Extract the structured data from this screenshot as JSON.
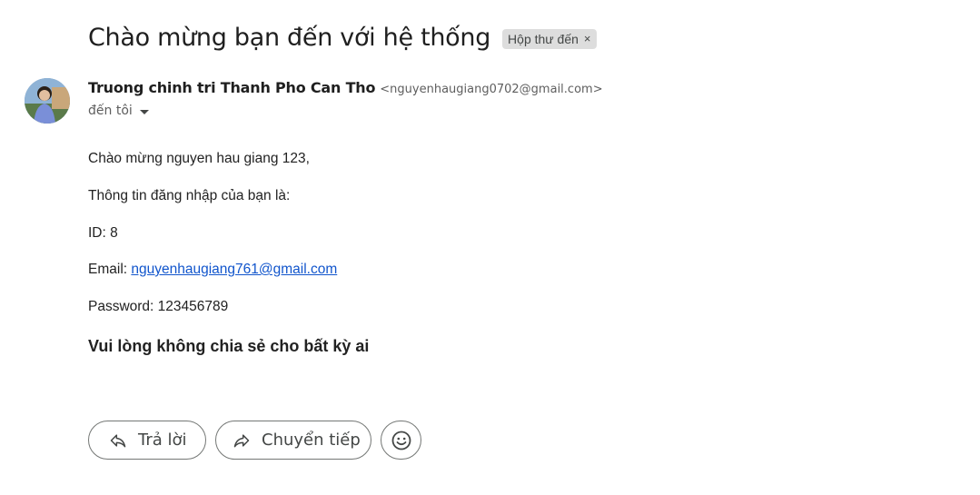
{
  "subject": "Chào mừng bạn đến với hệ thống",
  "label": {
    "text": "Hộp thư đến",
    "close": "×"
  },
  "sender": {
    "name": "Truong chinh tri Thanh Pho Can Tho",
    "email": "<nguyenhaugiang0702@gmail.com>",
    "to": "đến tôi"
  },
  "body": {
    "greeting": "Chào mừng nguyen hau giang 123,",
    "info_intro": "Thông tin đăng nhập của bạn là:",
    "id_line": "ID: 8",
    "email_label": "Email: ",
    "email_link": "nguyenhaugiang761@gmail.com",
    "password_line": "Password: 123456789",
    "warning": "Vui lòng không chia sẻ cho bất kỳ ai"
  },
  "actions": {
    "reply": "Trả lời",
    "forward": "Chuyển tiếp"
  },
  "icons": {
    "reply": "reply-icon",
    "forward": "forward-icon",
    "emoji": "emoji-icon",
    "caret": "caret-down-icon"
  },
  "colors": {
    "link": "#1155cc",
    "chip_bg": "#dddddd"
  }
}
